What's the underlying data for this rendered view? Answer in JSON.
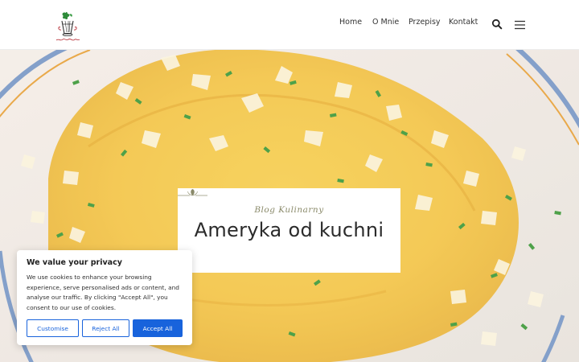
{
  "header": {
    "logo_alt": "Ameryka od kuchni",
    "nav": [
      {
        "label": "Home"
      },
      {
        "label": "O Mnie"
      },
      {
        "label": "Przepisy"
      },
      {
        "label": "Kontakt"
      }
    ],
    "search_icon": "search-icon",
    "menu_icon": "hamburger-menu-icon"
  },
  "hero": {
    "subtitle": "Blog Kulinarny",
    "title": "Ameryka od kuchni"
  },
  "cookie": {
    "title": "We value your privacy",
    "text": "We use cookies to enhance your browsing experience, serve personalised ads or content, and analyse our traffic. By clicking \"Accept All\", you consent to our use of cookies.",
    "buttons": {
      "customise": "Customise",
      "reject": "Reject All",
      "accept": "Accept All"
    }
  },
  "colors": {
    "accent": "#1863dc",
    "title_text": "#2b2b2b",
    "nav_text": "#333333"
  }
}
